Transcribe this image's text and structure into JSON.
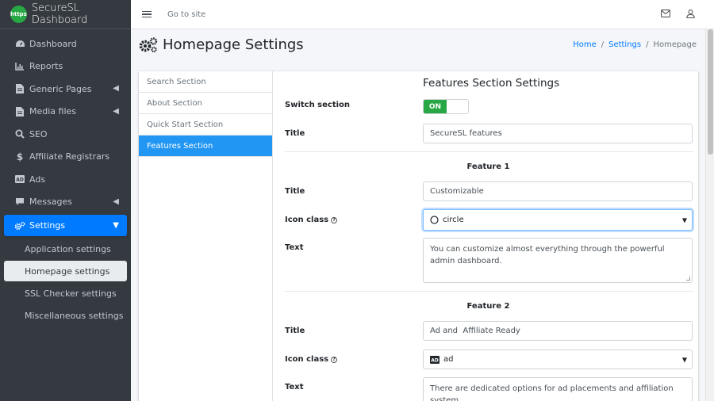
{
  "brand": {
    "logo_text": "https",
    "title": "SecureSL Dashboard"
  },
  "topbar": {
    "goto_label": "Go to site"
  },
  "sidebar": {
    "items": [
      {
        "label": "Dashboard",
        "icon": "tachometer-icon"
      },
      {
        "label": "Reports",
        "icon": "chart-icon"
      },
      {
        "label": "Generic Pages",
        "icon": "file-icon",
        "has_children": true
      },
      {
        "label": "Media files",
        "icon": "file-icon",
        "has_children": true
      },
      {
        "label": "SEO",
        "icon": "search-icon"
      },
      {
        "label": "Affiliate Registrars",
        "icon": "dollar-icon"
      },
      {
        "label": "Ads",
        "icon": "ad-icon"
      },
      {
        "label": "Messages",
        "icon": "comment-icon",
        "has_children": true
      },
      {
        "label": "Settings",
        "icon": "cogs-icon",
        "has_children": true,
        "active": true
      }
    ],
    "settings_children": [
      {
        "label": "Application settings"
      },
      {
        "label": "Homepage settings",
        "active": true
      },
      {
        "label": "SSL Checker settings"
      },
      {
        "label": "Miscellaneous settings"
      }
    ]
  },
  "header": {
    "title": "Homepage Settings"
  },
  "breadcrumb": {
    "home": "Home",
    "settings": "Settings",
    "current": "Homepage",
    "separator": "/"
  },
  "tabs": [
    {
      "label": "Search Section"
    },
    {
      "label": "About Section"
    },
    {
      "label": "Quick Start Section"
    },
    {
      "label": "Features Section",
      "active": true
    }
  ],
  "panel": {
    "title": "Features Section Settings",
    "switch_label": "Switch section",
    "switch_value": "ON",
    "title_label": "Title",
    "title_value": "SecureSL features",
    "feature1": {
      "heading": "Feature 1",
      "title_label": "Title",
      "title_value": "Customizable",
      "icon_label": "Icon class",
      "icon_value": "circle",
      "text_label": "Text",
      "text_value": "You can customize almost everything through the powerful admin dashboard."
    },
    "feature2": {
      "heading": "Feature 2",
      "title_label": "Title",
      "title_value": "Ad and  Affiliate Ready",
      "icon_label": "Icon class",
      "icon_value": "ad",
      "text_label": "Text",
      "text_value": "There are dedicated options for ad placements and affiliation system."
    }
  },
  "colors": {
    "sidebar": "#343a40",
    "primary": "#007bff",
    "active_tab": "#2196f3",
    "success": "#28a745"
  }
}
